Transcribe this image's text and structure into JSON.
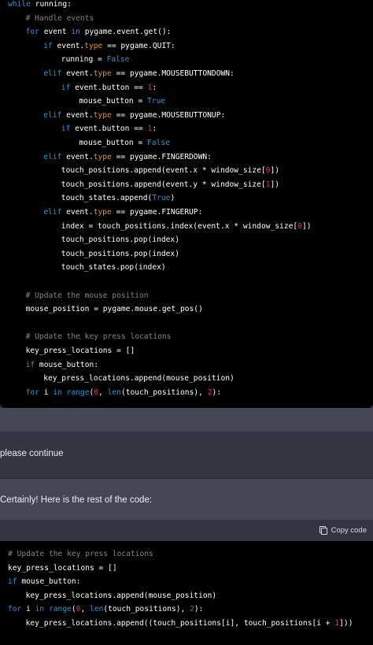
{
  "code_block_1": {
    "lines": [
      {
        "indent": 0,
        "tokens": [
          [
            "kw",
            "while"
          ],
          [
            "txt",
            " running:"
          ]
        ]
      },
      {
        "indent": 2,
        "tokens": [
          [
            "cm",
            "# Handle events"
          ]
        ]
      },
      {
        "indent": 2,
        "tokens": [
          [
            "kw",
            "for"
          ],
          [
            "txt",
            " event "
          ],
          [
            "kw",
            "in"
          ],
          [
            "txt",
            " pygame.event.get():"
          ]
        ]
      },
      {
        "indent": 4,
        "tokens": [
          [
            "kw",
            "if"
          ],
          [
            "txt",
            " event."
          ],
          [
            "attr",
            "type"
          ],
          [
            "txt",
            " == pygame.QUIT:"
          ]
        ]
      },
      {
        "indent": 6,
        "tokens": [
          [
            "txt",
            "running = "
          ],
          [
            "bool",
            "False"
          ]
        ]
      },
      {
        "indent": 4,
        "tokens": [
          [
            "kw",
            "elif"
          ],
          [
            "txt",
            " event."
          ],
          [
            "attr",
            "type"
          ],
          [
            "txt",
            " == pygame.MOUSEBUTTONDOWN:"
          ]
        ]
      },
      {
        "indent": 6,
        "tokens": [
          [
            "kw",
            "if"
          ],
          [
            "txt",
            " event.button == "
          ],
          [
            "num",
            "1"
          ],
          [
            "txt",
            ":"
          ]
        ]
      },
      {
        "indent": 8,
        "tokens": [
          [
            "txt",
            "mouse_button = "
          ],
          [
            "bool",
            "True"
          ]
        ]
      },
      {
        "indent": 4,
        "tokens": [
          [
            "kw",
            "elif"
          ],
          [
            "txt",
            " event."
          ],
          [
            "attr",
            "type"
          ],
          [
            "txt",
            " == pygame.MOUSEBUTTONUP:"
          ]
        ]
      },
      {
        "indent": 6,
        "tokens": [
          [
            "kw",
            "if"
          ],
          [
            "txt",
            " event.button == "
          ],
          [
            "num",
            "1"
          ],
          [
            "txt",
            ":"
          ]
        ]
      },
      {
        "indent": 8,
        "tokens": [
          [
            "txt",
            "mouse_button = "
          ],
          [
            "bool",
            "False"
          ]
        ]
      },
      {
        "indent": 4,
        "tokens": [
          [
            "kw",
            "elif"
          ],
          [
            "txt",
            " event."
          ],
          [
            "attr",
            "type"
          ],
          [
            "txt",
            " == pygame.FINGERDOWN:"
          ]
        ]
      },
      {
        "indent": 6,
        "tokens": [
          [
            "txt",
            "touch_positions.append(event.x * window_size["
          ],
          [
            "num",
            "0"
          ],
          [
            "txt",
            "])"
          ]
        ]
      },
      {
        "indent": 6,
        "tokens": [
          [
            "txt",
            "touch_positions.append(event.y * window_size["
          ],
          [
            "num",
            "1"
          ],
          [
            "txt",
            "])"
          ]
        ]
      },
      {
        "indent": 6,
        "tokens": [
          [
            "txt",
            "touch_states.append("
          ],
          [
            "bool",
            "True"
          ],
          [
            "txt",
            ")"
          ]
        ]
      },
      {
        "indent": 4,
        "tokens": [
          [
            "kw",
            "elif"
          ],
          [
            "txt",
            " event."
          ],
          [
            "attr",
            "type"
          ],
          [
            "txt",
            " == pygame.FINGERUP:"
          ]
        ]
      },
      {
        "indent": 6,
        "tokens": [
          [
            "txt",
            "index = touch_positions.index(event.x * window_size["
          ],
          [
            "num",
            "0"
          ],
          [
            "txt",
            "])"
          ]
        ]
      },
      {
        "indent": 6,
        "tokens": [
          [
            "txt",
            "touch_positions.pop(index)"
          ]
        ]
      },
      {
        "indent": 6,
        "tokens": [
          [
            "txt",
            "touch_positions.pop(index)"
          ]
        ]
      },
      {
        "indent": 6,
        "tokens": [
          [
            "txt",
            "touch_states.pop(index)"
          ]
        ]
      },
      {
        "indent": 0,
        "tokens": []
      },
      {
        "indent": 2,
        "tokens": [
          [
            "cm",
            "# Update the mouse position"
          ]
        ]
      },
      {
        "indent": 2,
        "tokens": [
          [
            "txt",
            "mouse_position = pygame.mouse.get_pos()"
          ]
        ]
      },
      {
        "indent": 0,
        "tokens": []
      },
      {
        "indent": 2,
        "tokens": [
          [
            "cm",
            "# Update the key press locations"
          ]
        ]
      },
      {
        "indent": 2,
        "tokens": [
          [
            "txt",
            "key_press_locations = []"
          ]
        ]
      },
      {
        "indent": 2,
        "tokens": [
          [
            "kw",
            "if"
          ],
          [
            "txt",
            " mouse_button:"
          ]
        ]
      },
      {
        "indent": 4,
        "tokens": [
          [
            "txt",
            "key_press_locations.append(mouse_position)"
          ]
        ]
      },
      {
        "indent": 2,
        "tokens": [
          [
            "kw",
            "for"
          ],
          [
            "txt",
            " i "
          ],
          [
            "kw",
            "in"
          ],
          [
            "txt",
            " "
          ],
          [
            "kw",
            "range"
          ],
          [
            "txt",
            "("
          ],
          [
            "num",
            "0"
          ],
          [
            "txt",
            ", "
          ],
          [
            "kw",
            "len"
          ],
          [
            "txt",
            "(touch_positions), "
          ],
          [
            "num",
            "2"
          ],
          [
            "txt",
            "):"
          ]
        ]
      }
    ]
  },
  "user_message": {
    "text": "please continue"
  },
  "assistant_message": {
    "text": "Certainly! Here is the rest of the code:"
  },
  "code_block_2": {
    "copy_label": "Copy code",
    "lines": [
      {
        "indent": 0,
        "tokens": [
          [
            "cm",
            "# Update the key press locations"
          ]
        ]
      },
      {
        "indent": 0,
        "tokens": [
          [
            "txt",
            "key_press_locations = []"
          ]
        ]
      },
      {
        "indent": 0,
        "tokens": [
          [
            "kw",
            "if"
          ],
          [
            "txt",
            " mouse_button:"
          ]
        ]
      },
      {
        "indent": 2,
        "tokens": [
          [
            "txt",
            "key_press_locations.append(mouse_position)"
          ]
        ]
      },
      {
        "indent": 0,
        "tokens": [
          [
            "kw",
            "for"
          ],
          [
            "txt",
            " i "
          ],
          [
            "kw",
            "in"
          ],
          [
            "txt",
            " "
          ],
          [
            "kw",
            "range"
          ],
          [
            "txt",
            "("
          ],
          [
            "num",
            "0"
          ],
          [
            "txt",
            ", "
          ],
          [
            "kw",
            "len"
          ],
          [
            "txt",
            "(touch_positions), "
          ],
          [
            "num",
            "2"
          ],
          [
            "txt",
            "):"
          ]
        ]
      },
      {
        "indent": 2,
        "tokens": [
          [
            "txt",
            "key_press_locations.append((touch_positions[i], touch_positions[i + "
          ],
          [
            "num",
            "1"
          ],
          [
            "txt",
            "]))"
          ]
        ]
      }
    ]
  },
  "colors": {
    "keyword": "#2e95d3",
    "comment": "#808080",
    "number": "#df3079",
    "attribute": "#e9950c",
    "code_background": "#000000",
    "page_background": "#343541",
    "assistant_background": "#444654"
  }
}
